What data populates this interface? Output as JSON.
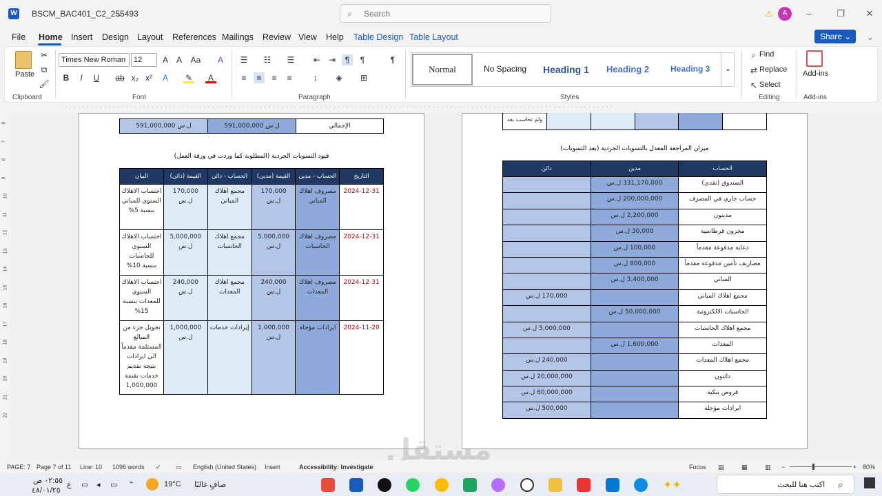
{
  "window": {
    "title": "BSCM_BAC401_C2_255493",
    "search_placeholder": "Search",
    "avatar_initial": "A"
  },
  "tabs": [
    "File",
    "Home",
    "Insert",
    "Design",
    "Layout",
    "References",
    "Mailings",
    "Review",
    "View",
    "Help",
    "Table Design",
    "Table Layout"
  ],
  "share_label": "Share",
  "ribbon": {
    "paste_label": "Paste",
    "clipboard_label": "Clipboard",
    "font_name": "Times New Roman",
    "font_size": "12",
    "font_label": "Font",
    "paragraph_label": "Paragraph",
    "styles_label": "Styles",
    "styles": [
      "Normal",
      "No Spacing",
      "Heading 1",
      "Heading 2",
      "Heading 3"
    ],
    "find_label": "Find",
    "replace_label": "Replace",
    "select_label": "Select",
    "editing_label": "Editing",
    "addins_label": "Add-ins",
    "addins_group_label": "Add-ins"
  },
  "left_page": {
    "total_row": {
      "label": "الإجمالي",
      "v1": "591,000,000 ل.س",
      "v2": "591,000,000 ل.س"
    },
    "caption": "قيود التسويات الجردية (المطلوبة كما وردت في ورقة العمل)",
    "headers": [
      "التاريخ",
      "الحساب - مدين",
      "القيمة (مدين)",
      "الحساب - دائن",
      "القيمة (دائن)",
      "البيان"
    ],
    "rows": [
      {
        "date": "2024-12-31",
        "debit_acc": "مصروف اهلاك المباني",
        "debit": "170,000 ل.س",
        "credit_acc": "مجمع اهلاك المباني",
        "credit": "170,000 ل.س",
        "desc": "احتساب الاهلاك السنوي للمباني بنسبة 5%"
      },
      {
        "date": "2024-12-31",
        "debit_acc": "مصروف اهلاك الحاسبات",
        "debit": "5,000,000 ل.س",
        "credit_acc": "مجمع اهلاك الحاسبات",
        "credit": "5,000,000 ل.س",
        "desc": "احتساب الاهلاك السنوي للحاسبات بنسبة 10%"
      },
      {
        "date": "2024-12-31",
        "debit_acc": "مصروف اهلاك المعدات",
        "debit": "240,000 ل.س",
        "credit_acc": "مجمع اهلاك المعدات",
        "credit": "240,000 ل.س",
        "desc": "احتساب الاهلاك السنوي للمعدات بنسبة 15%"
      },
      {
        "date": "2024-11-20",
        "debit_acc": "ايرادات مؤجلة",
        "debit": "1,000,000 ل.س",
        "credit_acc": "إيرادات خدمات",
        "credit": "1,000,000 ل.س",
        "desc": "تحويل جزء من المبالغ المستلمة مقدماً الى ايرادات نتيجة تقديم خدمات بقيمة 1,000,000"
      }
    ]
  },
  "right_page": {
    "top_fragment": "ولم تحاسب بعد",
    "caption": "ميزان المراجعة المعدل بالتسويات الجردية (بعد التسويات)",
    "headers": [
      "الحساب",
      "مدين",
      "دائن"
    ],
    "rows": [
      {
        "acc": "الصندوق (نقدي)",
        "debit": "331,170,000 ل.س",
        "credit": ""
      },
      {
        "acc": "حساب جاري في المصرف",
        "debit": "200,000,000 ل.س",
        "credit": ""
      },
      {
        "acc": "مدينون",
        "debit": "2,200,000 ل.س",
        "credit": ""
      },
      {
        "acc": "مخزون قرطاسية",
        "debit": "30,000 ل.س",
        "credit": ""
      },
      {
        "acc": "دعاية مدفوعة مقدماً",
        "debit": "100,000 ل.س",
        "credit": ""
      },
      {
        "acc": "مصاريف تأمين مدفوعة مقدماً",
        "debit": "800,000 ل.س",
        "credit": ""
      },
      {
        "acc": "المباني",
        "debit": "3,400,000 ل.س",
        "credit": ""
      },
      {
        "acc": "مجمع اهلاك المباني",
        "debit": "",
        "credit": "170,000 ل.س"
      },
      {
        "acc": "الحاسبات الالكترونية",
        "debit": "50,000,000 ل.س",
        "credit": ""
      },
      {
        "acc": "مجمع اهلاك الحاسبات",
        "debit": "",
        "credit": "5,000,000 ل.س"
      },
      {
        "acc": "المعدات",
        "debit": "1,600,000 ل.س",
        "credit": ""
      },
      {
        "acc": "مجمع اهلاك المعدات",
        "debit": "",
        "credit": "240,000 ل.س"
      },
      {
        "acc": "دائنون",
        "debit": "",
        "credit": "20,000,000 ل.س"
      },
      {
        "acc": "قروض بنكية",
        "debit": "",
        "credit": "60,000,000 ل.س"
      },
      {
        "acc": "ايرادات مؤجلة",
        "debit": "",
        "credit": "500,000 ل.س"
      }
    ]
  },
  "status": {
    "page": "PAGE: 7",
    "page_of": "Page 7 of 11",
    "line": "Line: 10",
    "words": "1096 words",
    "language": "English (United States)",
    "mode": "Insert",
    "accessibility": "Accessibility: Investigate",
    "focus": "Focus",
    "zoom": "80%"
  },
  "taskbar": {
    "time": "٠٢:٥٥ ص",
    "date": "٤٨/٠١/٢٥",
    "lang": "ع",
    "weather_temp": "19°C",
    "weather_desc": "صافٍ غالبًا",
    "search_text": "اكتب هنا للبحث"
  },
  "watermark": "مستقل"
}
